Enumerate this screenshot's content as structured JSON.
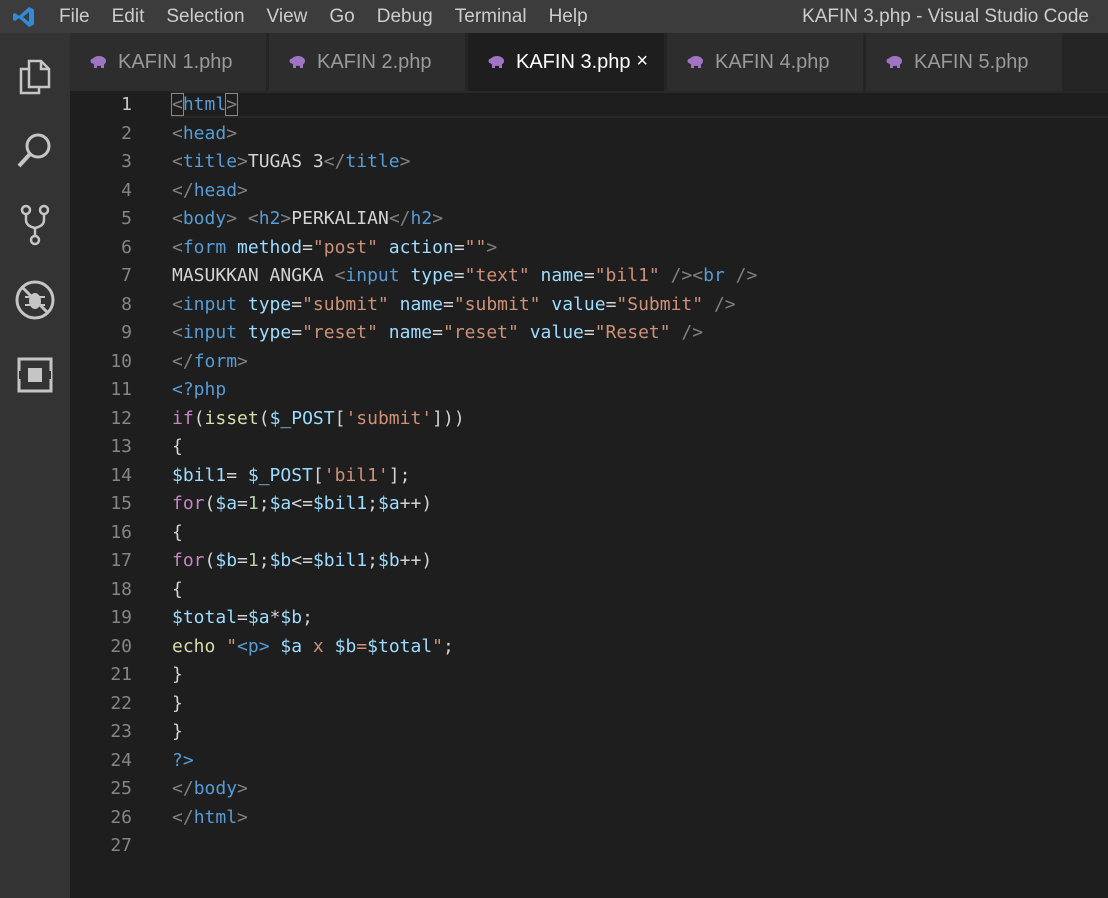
{
  "menu": [
    "File",
    "Edit",
    "Selection",
    "View",
    "Go",
    "Debug",
    "Terminal",
    "Help"
  ],
  "window_title": "KAFIN 3.php - Visual Studio Code",
  "tabs": [
    {
      "label": "KAFIN 1.php",
      "active": false
    },
    {
      "label": "KAFIN 2.php",
      "active": false
    },
    {
      "label": "KAFIN 3.php",
      "active": true
    },
    {
      "label": "KAFIN 4.php",
      "active": false
    },
    {
      "label": "KAFIN 5.php",
      "active": false
    }
  ],
  "close_glyph": "×",
  "active_line": 1,
  "colors": {
    "tag_punct": "#808080",
    "tag_name": "#569cd6",
    "attr": "#9cdcfe",
    "string": "#ce9178",
    "text": "#d4d4d4",
    "keyword": "#c586c0",
    "function": "#dcdcaa",
    "variable": "#9cdcfe",
    "number": "#b5cea8"
  },
  "lines": [
    [
      [
        "tg",
        "<"
      ],
      [
        "tn",
        "html"
      ],
      [
        "tg",
        ">"
      ]
    ],
    [
      [
        "tg",
        "<"
      ],
      [
        "tn",
        "head"
      ],
      [
        "tg",
        ">"
      ]
    ],
    [
      [
        "tg",
        "<"
      ],
      [
        "tn",
        "title"
      ],
      [
        "tg",
        ">"
      ],
      [
        "tx",
        "TUGAS 3"
      ],
      [
        "tg",
        "</"
      ],
      [
        "tn",
        "title"
      ],
      [
        "tg",
        ">"
      ]
    ],
    [
      [
        "tg",
        "</"
      ],
      [
        "tn",
        "head"
      ],
      [
        "tg",
        ">"
      ]
    ],
    [
      [
        "tg",
        "<"
      ],
      [
        "tn",
        "body"
      ],
      [
        "tg",
        ">"
      ],
      [
        "tx",
        " "
      ],
      [
        "tg",
        "<"
      ],
      [
        "tn",
        "h2"
      ],
      [
        "tg",
        ">"
      ],
      [
        "tx",
        "PERKALIAN"
      ],
      [
        "tg",
        "</"
      ],
      [
        "tn",
        "h2"
      ],
      [
        "tg",
        ">"
      ]
    ],
    [
      [
        "tg",
        "<"
      ],
      [
        "tn",
        "form"
      ],
      [
        "tx",
        " "
      ],
      [
        "at",
        "method"
      ],
      [
        "tx",
        "="
      ],
      [
        "st",
        "\"post\""
      ],
      [
        "tx",
        " "
      ],
      [
        "at",
        "action"
      ],
      [
        "tx",
        "="
      ],
      [
        "st",
        "\"\""
      ],
      [
        "tg",
        ">"
      ]
    ],
    [
      [
        "tx",
        "MASUKKAN ANGKA "
      ],
      [
        "tg",
        "<"
      ],
      [
        "tn",
        "input"
      ],
      [
        "tx",
        " "
      ],
      [
        "at",
        "type"
      ],
      [
        "tx",
        "="
      ],
      [
        "st",
        "\"text\""
      ],
      [
        "tx",
        " "
      ],
      [
        "at",
        "name"
      ],
      [
        "tx",
        "="
      ],
      [
        "st",
        "\"bil1\""
      ],
      [
        "tx",
        " "
      ],
      [
        "tg",
        "/><"
      ],
      [
        "tn",
        "br"
      ],
      [
        "tx",
        " "
      ],
      [
        "tg",
        "/>"
      ]
    ],
    [
      [
        "tg",
        "<"
      ],
      [
        "tn",
        "input"
      ],
      [
        "tx",
        " "
      ],
      [
        "at",
        "type"
      ],
      [
        "tx",
        "="
      ],
      [
        "st",
        "\"submit\""
      ],
      [
        "tx",
        " "
      ],
      [
        "at",
        "name"
      ],
      [
        "tx",
        "="
      ],
      [
        "st",
        "\"submit\""
      ],
      [
        "tx",
        " "
      ],
      [
        "at",
        "value"
      ],
      [
        "tx",
        "="
      ],
      [
        "st",
        "\"Submit\""
      ],
      [
        "tx",
        " "
      ],
      [
        "tg",
        "/>"
      ]
    ],
    [
      [
        "tg",
        "<"
      ],
      [
        "tn",
        "input"
      ],
      [
        "tx",
        " "
      ],
      [
        "at",
        "type"
      ],
      [
        "tx",
        "="
      ],
      [
        "st",
        "\"reset\""
      ],
      [
        "tx",
        " "
      ],
      [
        "at",
        "name"
      ],
      [
        "tx",
        "="
      ],
      [
        "st",
        "\"reset\""
      ],
      [
        "tx",
        " "
      ],
      [
        "at",
        "value"
      ],
      [
        "tx",
        "="
      ],
      [
        "st",
        "\"Reset\""
      ],
      [
        "tx",
        " "
      ],
      [
        "tg",
        "/>"
      ]
    ],
    [
      [
        "tg",
        "</"
      ],
      [
        "tn",
        "form"
      ],
      [
        "tg",
        ">"
      ]
    ],
    [
      [
        "ph",
        "<?php"
      ]
    ],
    [
      [
        "kw",
        "if"
      ],
      [
        "tx",
        "("
      ],
      [
        "fn",
        "isset"
      ],
      [
        "tx",
        "("
      ],
      [
        "vr",
        "$_POST"
      ],
      [
        "tx",
        "["
      ],
      [
        "st",
        "'submit'"
      ],
      [
        "tx",
        "]))"
      ]
    ],
    [
      [
        "tx",
        "{"
      ]
    ],
    [
      [
        "vr",
        "$bil1"
      ],
      [
        "tx",
        "= "
      ],
      [
        "vr",
        "$_POST"
      ],
      [
        "tx",
        "["
      ],
      [
        "st",
        "'bil1'"
      ],
      [
        "tx",
        "];"
      ]
    ],
    [
      [
        "kw",
        "for"
      ],
      [
        "tx",
        "("
      ],
      [
        "vr",
        "$a"
      ],
      [
        "tx",
        "="
      ],
      [
        "nm",
        "1"
      ],
      [
        "tx",
        ";"
      ],
      [
        "vr",
        "$a"
      ],
      [
        "tx",
        "<="
      ],
      [
        "vr",
        "$bil1"
      ],
      [
        "tx",
        ";"
      ],
      [
        "vr",
        "$a"
      ],
      [
        "tx",
        "++)"
      ]
    ],
    [
      [
        "tx",
        "{"
      ]
    ],
    [
      [
        "kw",
        "for"
      ],
      [
        "tx",
        "("
      ],
      [
        "vr",
        "$b"
      ],
      [
        "tx",
        "="
      ],
      [
        "nm",
        "1"
      ],
      [
        "tx",
        ";"
      ],
      [
        "vr",
        "$b"
      ],
      [
        "tx",
        "<="
      ],
      [
        "vr",
        "$bil1"
      ],
      [
        "tx",
        ";"
      ],
      [
        "vr",
        "$b"
      ],
      [
        "tx",
        "++)"
      ]
    ],
    [
      [
        "tx",
        "{"
      ]
    ],
    [
      [
        "vr",
        "$total"
      ],
      [
        "tx",
        "="
      ],
      [
        "vr",
        "$a"
      ],
      [
        "tx",
        "*"
      ],
      [
        "vr",
        "$b"
      ],
      [
        "tx",
        ";"
      ]
    ],
    [
      [
        "fn",
        "echo"
      ],
      [
        "tx",
        " "
      ],
      [
        "st",
        "\""
      ],
      [
        "tn",
        "<p>"
      ],
      [
        "st",
        " "
      ],
      [
        "vr",
        "$a"
      ],
      [
        "st",
        " x "
      ],
      [
        "vr",
        "$b"
      ],
      [
        "st",
        "="
      ],
      [
        "vr",
        "$total"
      ],
      [
        "st",
        "\""
      ],
      [
        "tx",
        ";"
      ]
    ],
    [
      [
        "tx",
        "}"
      ]
    ],
    [
      [
        "tx",
        "}"
      ]
    ],
    [
      [
        "tx",
        "}"
      ]
    ],
    [
      [
        "ph",
        "?>"
      ]
    ],
    [
      [
        "tg",
        "</"
      ],
      [
        "tn",
        "body"
      ],
      [
        "tg",
        ">"
      ]
    ],
    [
      [
        "tg",
        "</"
      ],
      [
        "tn",
        "html"
      ],
      [
        "tg",
        ">"
      ]
    ],
    []
  ]
}
